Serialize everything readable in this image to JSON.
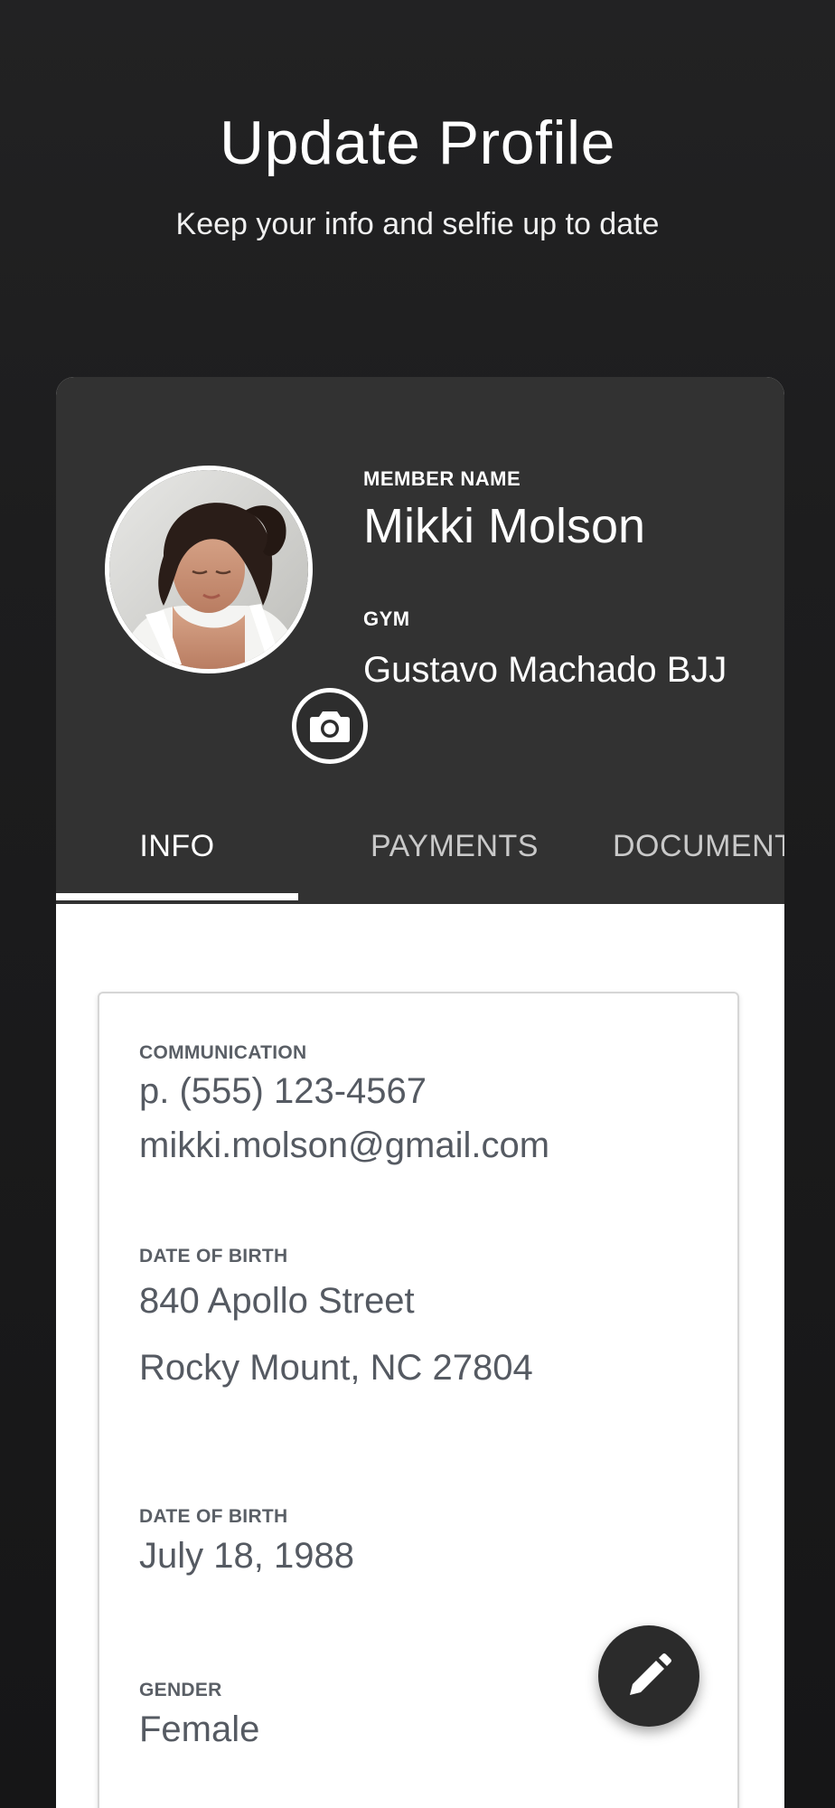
{
  "header": {
    "title": "Update Profile",
    "subtitle": "Keep your info and selfie up to date"
  },
  "profile": {
    "member_name_label": "MEMBER NAME",
    "member_name": "Mikki Molson",
    "gym_label": "GYM",
    "gym_name": "Gustavo Machado BJJ",
    "avatar_icon": "profile-photo",
    "camera_icon": "camera-icon"
  },
  "tabs": [
    {
      "label": "INFO",
      "active": true
    },
    {
      "label": "PAYMENTS",
      "active": false
    },
    {
      "label": "DOCUMENTS",
      "active": false
    }
  ],
  "info": {
    "communication_label": "COMMUNICATION",
    "phone": "p. (555) 123-4567",
    "email": "mikki.molson@gmail.com",
    "address_label": "DATE OF BIRTH",
    "address_line1": "840 Apollo Street",
    "address_line2": "Rocky Mount, NC 27804",
    "dob_label": "DATE OF BIRTH",
    "dob": "July 18, 1988",
    "gender_label": "GENDER",
    "gender": "Female"
  },
  "fab": {
    "icon": "pencil-icon"
  },
  "colors": {
    "background": "#1e1e1f",
    "card_header": "#323232",
    "card_body": "#ffffff",
    "label_gray": "#5a5f66",
    "value_gray": "#555a62",
    "fab": "#2b2b2b"
  }
}
